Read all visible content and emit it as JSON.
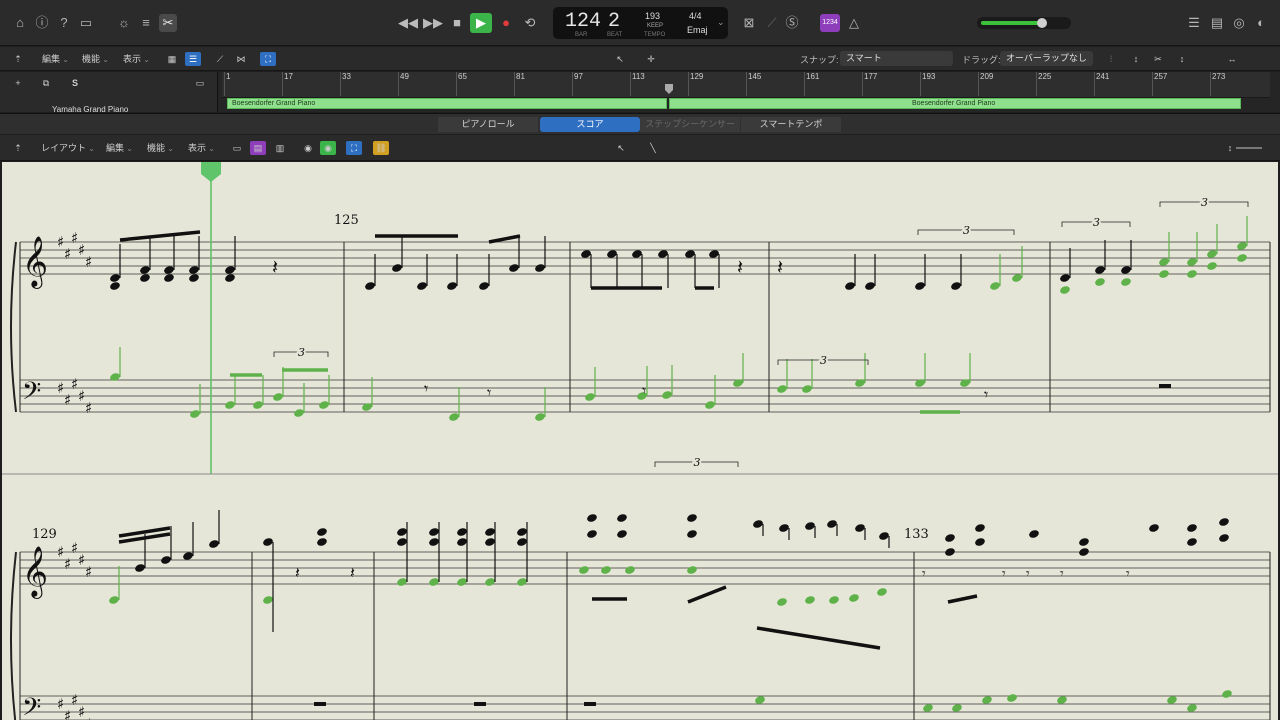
{
  "top_bar": {
    "lcd": {
      "bar": "124",
      "beat": "2",
      "bar_caption": "BAR",
      "beat_caption": "BEAT",
      "tempo": "193",
      "tempo_mode": "KEEP",
      "tempo_caption": "TEMPO",
      "time_signature": "4/4",
      "key": "Emaj"
    },
    "badge": "1234"
  },
  "toolbar2": {
    "edit": "編集",
    "functions": "機能",
    "view": "表示",
    "snap_label": "スナップ:",
    "snap_value": "スマート",
    "drag_label": "ドラッグ:",
    "drag_value": "オーバーラップなし"
  },
  "tracks": {
    "s_button": "S",
    "track_name": "Yamaha Grand Piano",
    "ruler_marks": [
      "1",
      "17",
      "33",
      "49",
      "65",
      "81",
      "97",
      "113",
      "129",
      "145",
      "161",
      "177",
      "193",
      "209",
      "225",
      "241",
      "257",
      "273"
    ],
    "region_name_1": "Boesendorfer Grand Piano",
    "region_name_2": "Boesendorfer Grand Piano"
  },
  "editor_tabs": {
    "piano_roll": "ピアノロール",
    "score": "スコア",
    "step_sequencer": "ステップシーケンサー",
    "smart_tempo": "スマートテンポ"
  },
  "score_toolbar": {
    "layout": "レイアウト",
    "edit": "編集",
    "functions": "機能",
    "view": "表示"
  },
  "score": {
    "measure_numbers": [
      "125",
      "129",
      "133"
    ],
    "tuplet_labels": [
      "3",
      "3",
      "3",
      "3",
      "3",
      "3"
    ],
    "colors": {
      "paper": "#e6e6d8",
      "highlight_note": "#5fb24a",
      "playhead": "#5fc46a"
    }
  }
}
